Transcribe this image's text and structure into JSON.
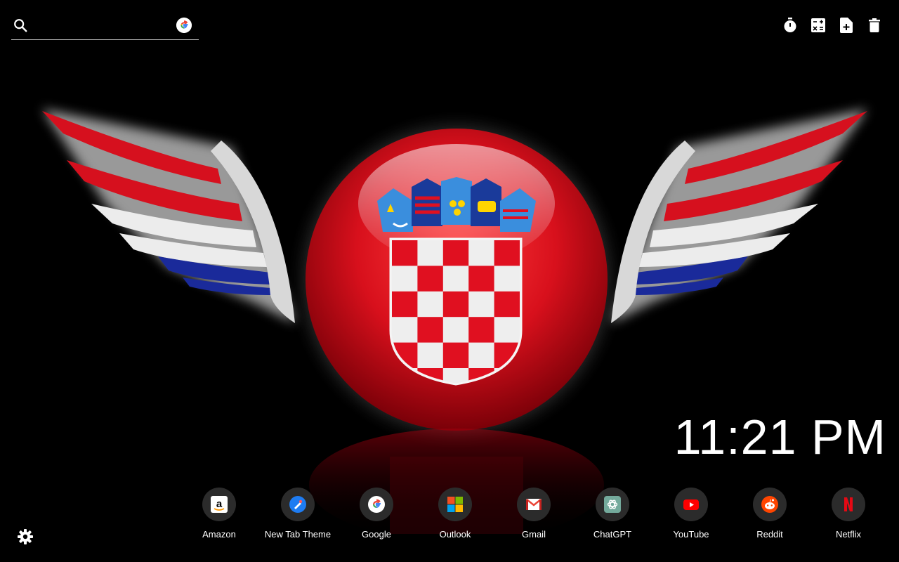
{
  "search": {
    "placeholder": "",
    "value": "",
    "engine": "google"
  },
  "toolbar": {
    "icons": [
      "timer-icon",
      "calculator-icon",
      "new-note-icon",
      "trash-icon"
    ]
  },
  "clock": {
    "time": "11:21 PM"
  },
  "shortcuts": [
    {
      "label": "Amazon",
      "icon": "amazon-icon"
    },
    {
      "label": "New Tab Theme",
      "icon": "new-tab-theme-icon"
    },
    {
      "label": "Google",
      "icon": "google-icon"
    },
    {
      "label": "Outlook",
      "icon": "outlook-icon"
    },
    {
      "label": "Gmail",
      "icon": "gmail-icon"
    },
    {
      "label": "ChatGPT",
      "icon": "chatgpt-icon"
    },
    {
      "label": "YouTube",
      "icon": "youtube-icon"
    },
    {
      "label": "Reddit",
      "icon": "reddit-icon"
    },
    {
      "label": "Netflix",
      "icon": "netflix-icon"
    }
  ],
  "settings": {
    "icon": "gear-icon"
  },
  "colors": {
    "background": "#000000",
    "emblem_red": "#e01020",
    "text": "#ffffff",
    "shortcut_circle": "#2b2b2b"
  }
}
